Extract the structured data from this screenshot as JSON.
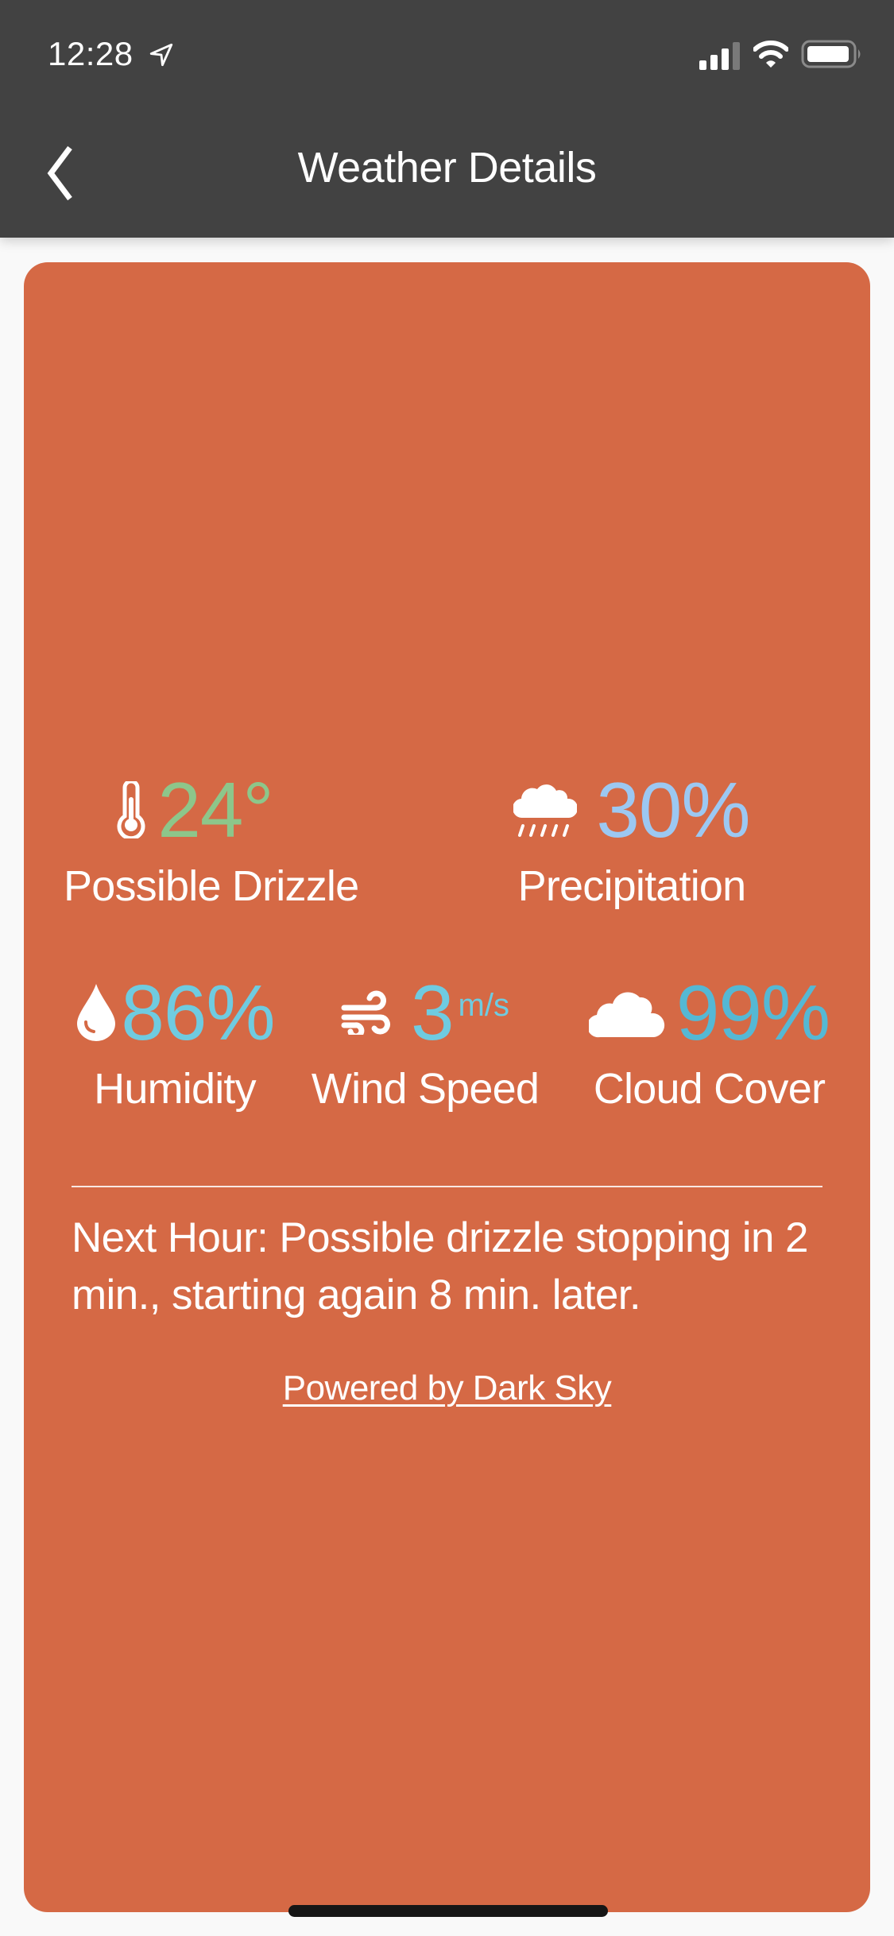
{
  "status_bar": {
    "time": "12:28",
    "location_icon": "location-arrow-icon",
    "signal_bars_filled": 3,
    "signal_bars_total": 4,
    "wifi_icon": "wifi-icon",
    "battery_icon": "battery-icon"
  },
  "header": {
    "title": "Weather Details",
    "back_icon": "chevron-left-icon"
  },
  "card": {
    "background_color": "#D56945",
    "stats": [
      {
        "id": "temperature",
        "icon": "thermometer-icon",
        "value": "24°",
        "unit": "",
        "label": "Possible Drizzle",
        "color": "#8DC68A"
      },
      {
        "id": "precipitation",
        "icon": "cloud-rain-icon",
        "value": "30%",
        "unit": "",
        "label": "Precipitation",
        "color": "#9CC8F2"
      },
      {
        "id": "humidity",
        "icon": "water-drop-icon",
        "value": "86%",
        "unit": "",
        "label": "Humidity",
        "color": "#6FCBE0"
      },
      {
        "id": "wind-speed",
        "icon": "wind-icon",
        "value": "3",
        "unit": "m/s",
        "label": "Wind Speed",
        "color": "#6FCBE0"
      },
      {
        "id": "cloud-cover",
        "icon": "cloud-icon",
        "value": "99%",
        "unit": "",
        "label": "Cloud Cover",
        "color": "#55B8D4"
      }
    ],
    "summary": "Next Hour: Possible drizzle stopping in 2 min., starting again 8 min. later.",
    "powered_by": "Powered by Dark Sky"
  }
}
